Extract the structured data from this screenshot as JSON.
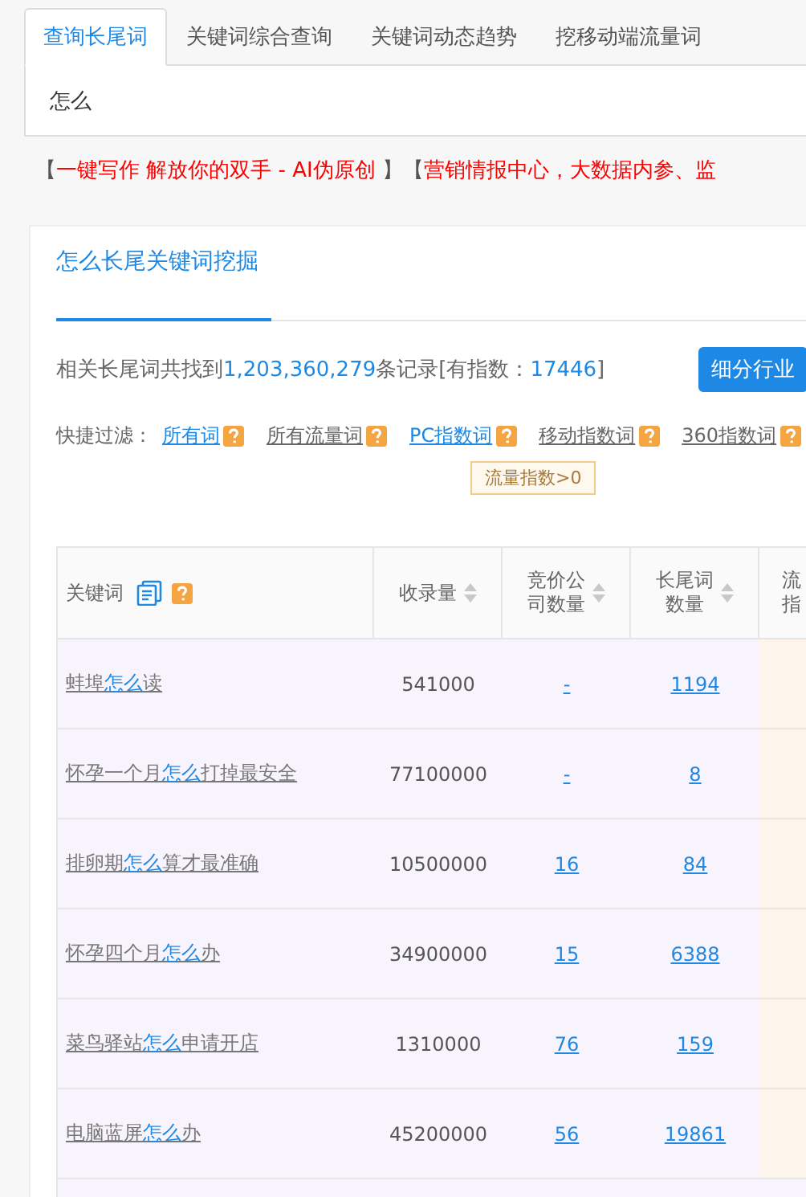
{
  "tabs": [
    {
      "label": "查询长尾词",
      "selected": true
    },
    {
      "label": "关键词综合查询",
      "selected": false
    },
    {
      "label": "关键词动态趋势",
      "selected": false
    },
    {
      "label": "挖移动端流量词",
      "selected": false
    }
  ],
  "search": {
    "value": "怎么"
  },
  "promo": [
    {
      "kind": "bracket",
      "text": "【"
    },
    {
      "kind": "link",
      "text": "一键写作 解放你的双手 - AI伪原创"
    },
    {
      "kind": "bracket",
      "text": " 】【"
    },
    {
      "kind": "link",
      "text": "营销情报中心，大数据内参、监"
    }
  ],
  "card": {
    "tab": "怎么长尾关键词挖掘",
    "summary": {
      "prefix": "相关长尾词共找到",
      "total": "1,203,360,279",
      "middle": "条记录[有指数：",
      "indexed": "17446",
      "suffix": "]"
    },
    "button": "细分行业",
    "filter_label": "快捷过滤：",
    "filters": [
      {
        "label": "所有词",
        "selected": true
      },
      {
        "label": "所有流量词",
        "selected": false
      },
      {
        "label": "PC指数词",
        "selected": true
      },
      {
        "label": "移动指数词",
        "selected": false
      },
      {
        "label": "360指数词",
        "selected": false
      }
    ],
    "tag": "流量指数>0"
  },
  "table": {
    "columns": [
      {
        "lines": [
          "关键词"
        ],
        "kind": "keyword"
      },
      {
        "lines": [
          "收录量"
        ],
        "kind": "sortable"
      },
      {
        "lines": [
          "竞价公",
          "司数量"
        ],
        "kind": "sortable"
      },
      {
        "lines": [
          "长尾词",
          "数量"
        ],
        "kind": "sortable"
      },
      {
        "lines": [
          "流",
          "指"
        ],
        "kind": "cut"
      }
    ],
    "rows": [
      {
        "keyword": {
          "before": "蚌埠",
          "match": "怎么",
          "after": "读"
        },
        "indexed": "541000",
        "bidders": "-",
        "longtail": "1194"
      },
      {
        "keyword": {
          "before": "怀孕一个月",
          "match": "怎么",
          "after": "打掉最安全"
        },
        "indexed": "77100000",
        "bidders": "-",
        "longtail": "8"
      },
      {
        "keyword": {
          "before": "排卵期",
          "match": "怎么",
          "after": "算才最准确"
        },
        "indexed": "10500000",
        "bidders": "16",
        "longtail": "84"
      },
      {
        "keyword": {
          "before": "怀孕四个月",
          "match": "怎么",
          "after": "办"
        },
        "indexed": "34900000",
        "bidders": "15",
        "longtail": "6388"
      },
      {
        "keyword": {
          "before": "菜鸟驿站",
          "match": "怎么",
          "after": "申请开店"
        },
        "indexed": "1310000",
        "bidders": "76",
        "longtail": "159"
      },
      {
        "keyword": {
          "before": "电脑蓝屏",
          "match": "怎么",
          "after": "办"
        },
        "indexed": "45200000",
        "bidders": "56",
        "longtail": "19861"
      }
    ]
  }
}
